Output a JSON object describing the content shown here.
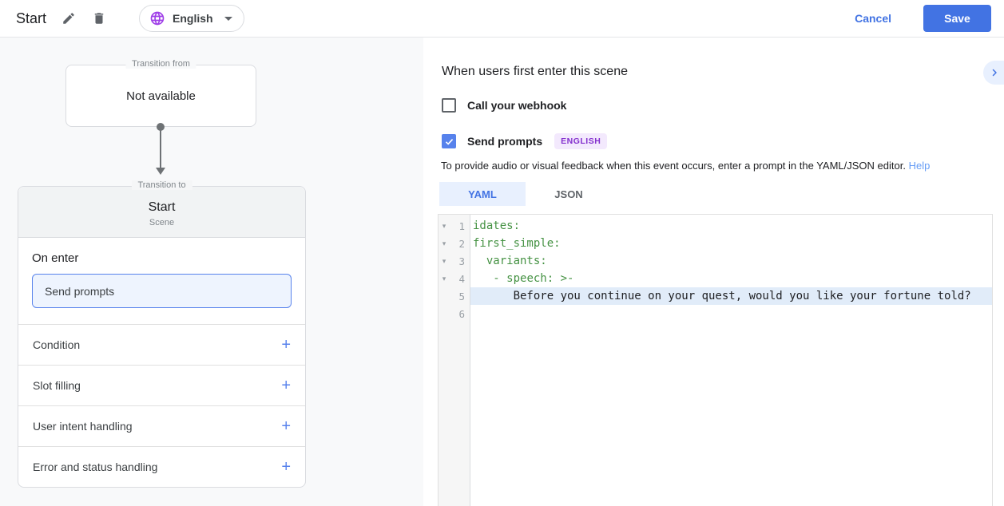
{
  "topbar": {
    "title": "Start",
    "language": "English",
    "cancel_label": "Cancel",
    "save_label": "Save"
  },
  "canvas": {
    "transition_from": {
      "label": "Transition from",
      "value": "Not available"
    },
    "transition_to": {
      "label": "Transition to",
      "title": "Start",
      "subtitle": "Scene"
    },
    "on_enter": {
      "label": "On enter",
      "chip": "Send prompts"
    },
    "sections": [
      {
        "label": "Condition",
        "add": "+"
      },
      {
        "label": "Slot filling",
        "add": "+"
      },
      {
        "label": "User intent handling",
        "add": "+"
      },
      {
        "label": "Error and status handling",
        "add": "+"
      }
    ]
  },
  "panel": {
    "heading": "When users first enter this scene",
    "webhook": {
      "label": "Call your webhook",
      "checked": false
    },
    "send_prompts": {
      "label": "Send prompts",
      "badge": "ENGLISH",
      "checked": true
    },
    "description": "To provide audio or visual feedback when this event occurs, enter a prompt in the YAML/JSON editor.",
    "help_label": "Help",
    "tabs": [
      {
        "label": "YAML",
        "active": true
      },
      {
        "label": "JSON",
        "active": false
      }
    ],
    "editor": {
      "lines": [
        {
          "num": "1",
          "fold": true,
          "highlight": false,
          "segments": [
            {
              "text": "idates:",
              "type": "key"
            }
          ]
        },
        {
          "num": "2",
          "fold": true,
          "highlight": false,
          "segments": [
            {
              "text": "first_simple:",
              "type": "key"
            }
          ]
        },
        {
          "num": "3",
          "fold": true,
          "highlight": false,
          "segments": [
            {
              "text": "  ",
              "type": "plain"
            },
            {
              "text": "variants:",
              "type": "key"
            }
          ]
        },
        {
          "num": "4",
          "fold": true,
          "highlight": false,
          "segments": [
            {
              "text": "   ",
              "type": "plain"
            },
            {
              "text": "- speech: >-",
              "type": "key"
            }
          ]
        },
        {
          "num": "5",
          "fold": false,
          "highlight": true,
          "segments": [
            {
              "text": "      Before you continue on your quest, would you like your fortune told?",
              "type": "plain"
            }
          ]
        },
        {
          "num": "6",
          "fold": false,
          "highlight": false,
          "segments": []
        }
      ]
    }
  },
  "colors": {
    "accent_blue": "#4273e3",
    "checkbox_blue": "#5782ec",
    "light_blue_bg": "#e8f0fe",
    "yaml_key_green": "#459243",
    "badge_purple": "#8430ce",
    "badge_bg": "#f3e9fd",
    "globe_purple": "#9f3ee8"
  }
}
